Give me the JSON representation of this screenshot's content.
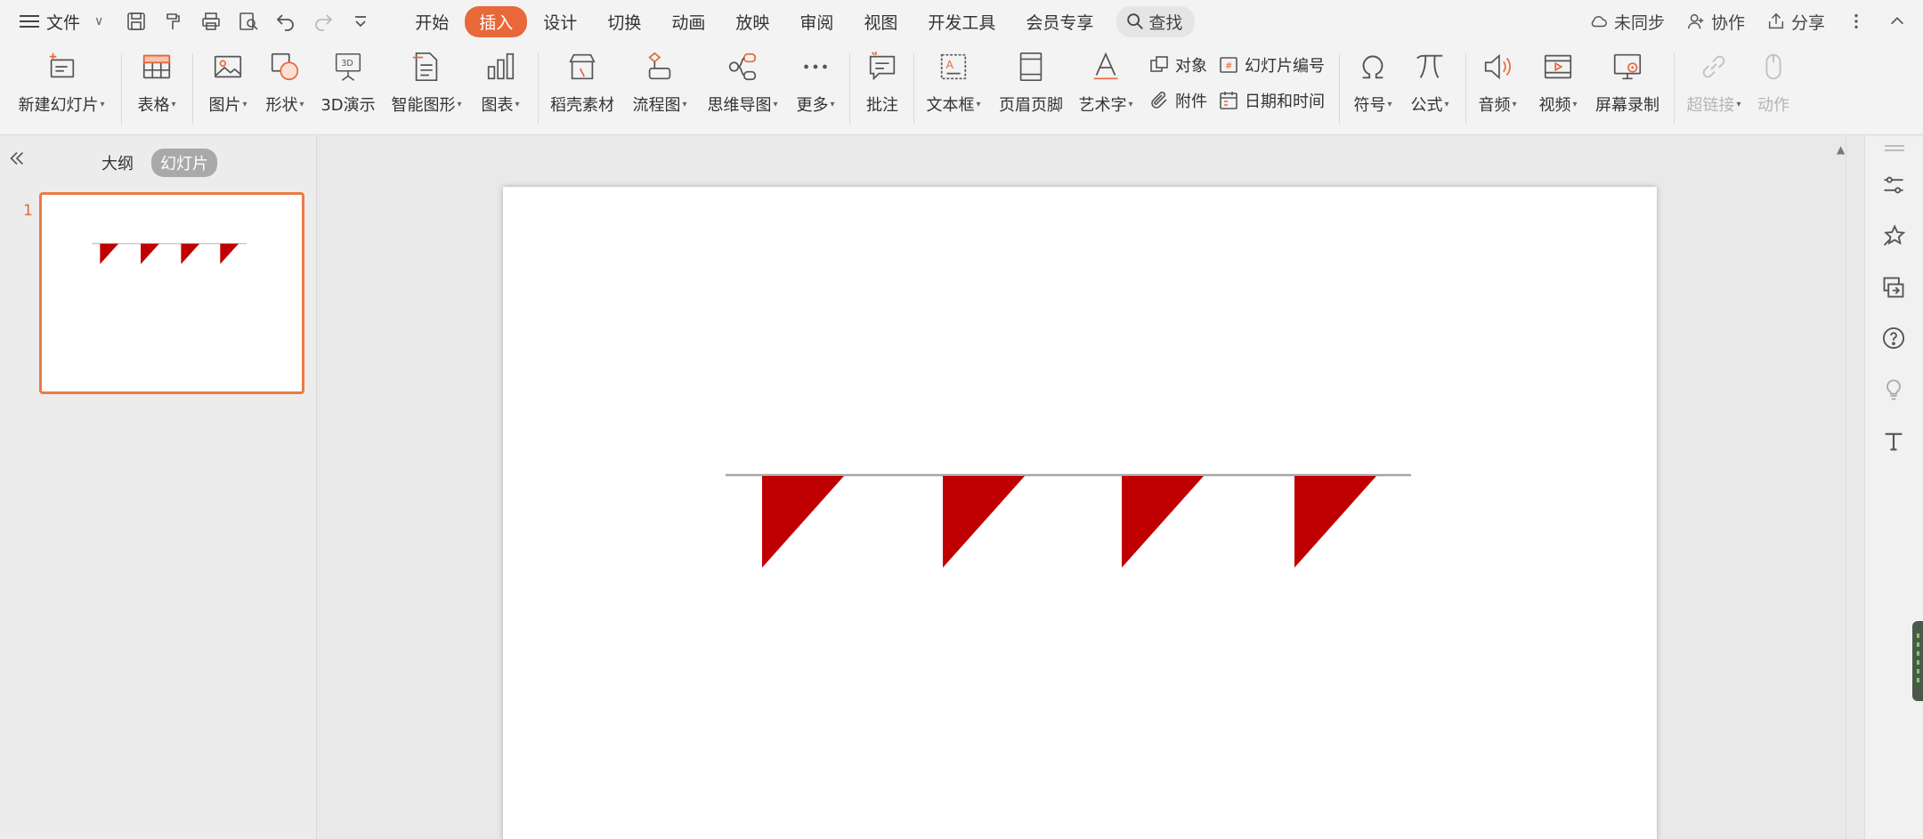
{
  "menubar": {
    "file_label": "文件",
    "tabs": [
      "开始",
      "插入",
      "设计",
      "切换",
      "动画",
      "放映",
      "审阅",
      "视图",
      "开发工具",
      "会员专享"
    ],
    "active_tab": "插入",
    "search_label": "查找",
    "sync_label": "未同步",
    "collab_label": "协作",
    "share_label": "分享"
  },
  "ribbon": {
    "new_slide": "新建幻灯片",
    "table": "表格",
    "picture": "图片",
    "shape": "形状",
    "demo3d": "3D演示",
    "smartart": "智能图形",
    "chart": "图表",
    "material": "稻壳素材",
    "flowchart": "流程图",
    "mindmap": "思维导图",
    "more": "更多",
    "comment": "批注",
    "textbox": "文本框",
    "header_footer": "页眉页脚",
    "wordart": "艺术字",
    "object": "对象",
    "slide_number": "幻灯片编号",
    "attachment": "附件",
    "datetime": "日期和时间",
    "symbol": "符号",
    "formula": "公式",
    "audio": "音频",
    "video": "视频",
    "screen_record": "屏幕录制",
    "hyperlink": "超链接",
    "action": "动作"
  },
  "slidepane": {
    "tab_outline": "大纲",
    "tab_slides": "幻灯片",
    "slide_number": "1"
  },
  "slide": {
    "flag_color": "#c00000",
    "line_color": "#a6a6a6"
  },
  "colors": {
    "accent": "#e8683a",
    "thumb_border": "#ea7b43"
  }
}
